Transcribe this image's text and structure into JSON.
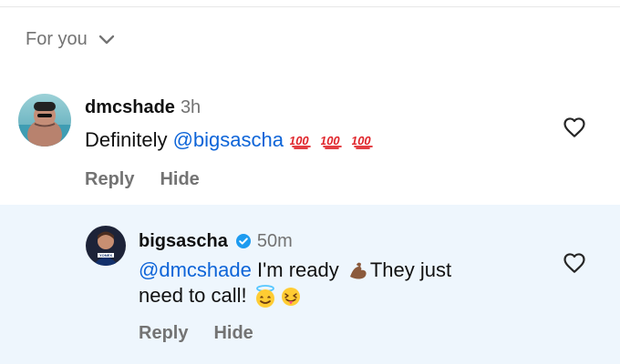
{
  "header": {
    "sort_label": "For you"
  },
  "icons": {
    "chevron": "chevron-down-icon",
    "heart": "heart-icon",
    "verified": "verified-badge-icon",
    "hundred": "hundred-points-icon",
    "muscle": "flexed-biceps-icon",
    "halo": "smiling-face-with-halo-icon",
    "tongue": "squinting-face-with-tongue-icon"
  },
  "colors": {
    "mention": "#0d64d8",
    "reply_background": "#eef6fd",
    "verified": "#1d9bf0"
  },
  "comments": [
    {
      "username": "dmcshade",
      "time": "3h",
      "text_plain": "Definitely ",
      "mention": "@bigsascha",
      "emojis": [
        "💯",
        "💯",
        "💯"
      ],
      "actions": [
        "Reply",
        "Hide"
      ]
    },
    {
      "username": "bigsascha",
      "time": "50m",
      "mention": "@dmcshade",
      "text_part1": " I'm ready ",
      "text_part2": "They just",
      "text_part3": "need to call! ",
      "emojis": [
        "💪",
        "😇",
        "😝"
      ],
      "actions": [
        "Reply",
        "Hide"
      ]
    }
  ]
}
